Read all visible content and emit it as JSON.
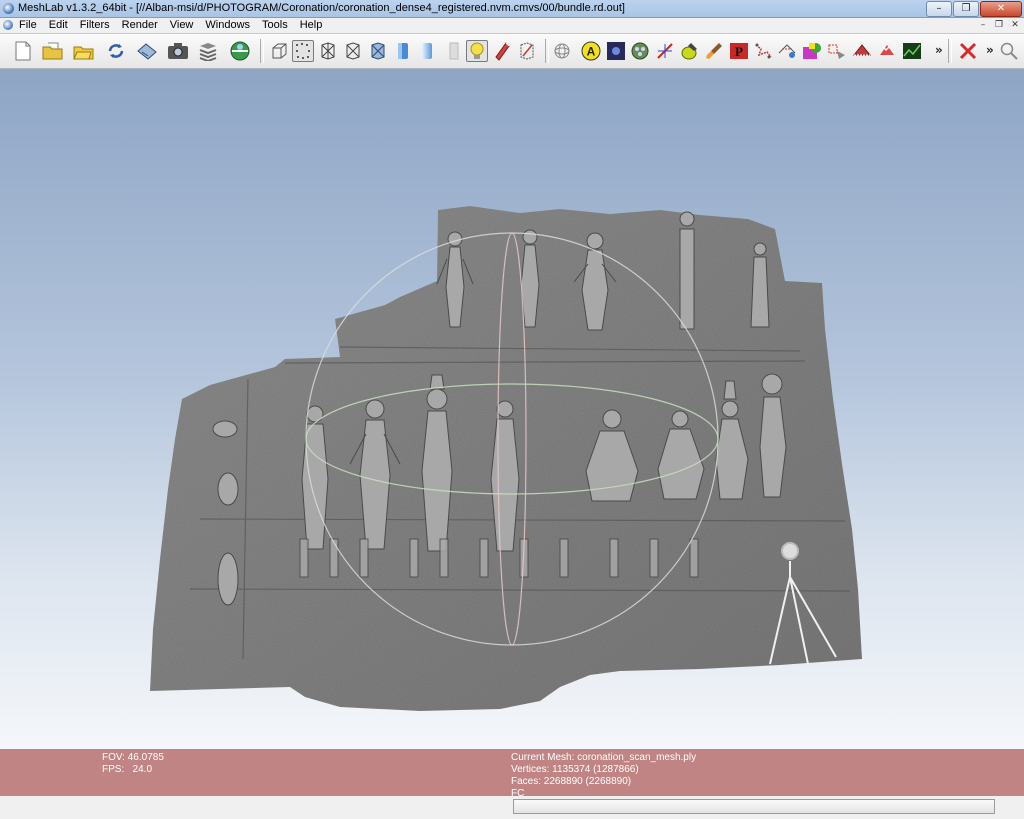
{
  "window": {
    "title": "MeshLab v1.3.2_64bit - [//Alban-msi/d/PHOTOGRAM/Coronation/coronation_dense4_registered.nvm.cmvs/00/bundle.rd.out]",
    "minimize_label": "–",
    "restore_label": "❐",
    "close_label": "✕"
  },
  "menubar": {
    "items": [
      "File",
      "Edit",
      "Filters",
      "Render",
      "View",
      "Windows",
      "Tools",
      "Help"
    ],
    "mdi_minimize": "–",
    "mdi_restore": "❐",
    "mdi_close": "✕"
  },
  "toolbar": {
    "more_label_1": "»",
    "more_label_2": "»"
  },
  "info": {
    "fov": "FOV: 46.0785",
    "fps": "FPS:   24.0",
    "current_mesh": "Current Mesh: coronation_scan_mesh.ply",
    "vertices": "Vertices: 1135374 (1287866)",
    "faces": "Faces: 2268890 (2268890)",
    "fc": "FC"
  },
  "colors": {
    "infobar": "#c08484",
    "viewport_top": "#8ea5c5",
    "viewport_bottom": "#f5f7fa",
    "mesh_gray": "#8a8a8a"
  }
}
